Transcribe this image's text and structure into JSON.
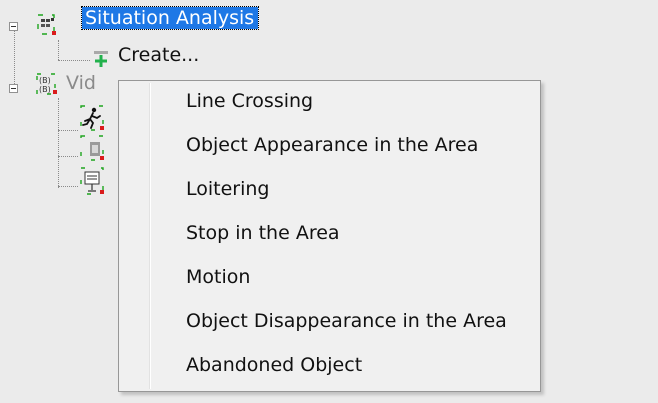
{
  "tree": {
    "root": {
      "label": "Situation Analysis",
      "icon": "camera-group-icon",
      "selected": true
    },
    "create": {
      "label": "Create...",
      "icon": "plus-icon"
    },
    "video_node": {
      "label": "Vid",
      "icon": "video-detector-icon"
    },
    "child_icons": [
      "running-person-icon",
      "object-tracker-icon",
      "detector-panel-icon"
    ]
  },
  "context_menu": {
    "items": [
      {
        "label": "Line Crossing"
      },
      {
        "label": "Object Appearance in the Area"
      },
      {
        "label": "Loitering"
      },
      {
        "label": "Stop in the Area"
      },
      {
        "label": "Motion"
      },
      {
        "label": "Object Disappearance in the Area"
      },
      {
        "label": "Abandoned Object"
      }
    ]
  },
  "colors": {
    "selection": "#1e78e6",
    "menu_bg": "#f0f0f0",
    "create_plus": "#22b14c",
    "marker_green": "#1ea51e",
    "marker_red": "#d91b1b"
  }
}
